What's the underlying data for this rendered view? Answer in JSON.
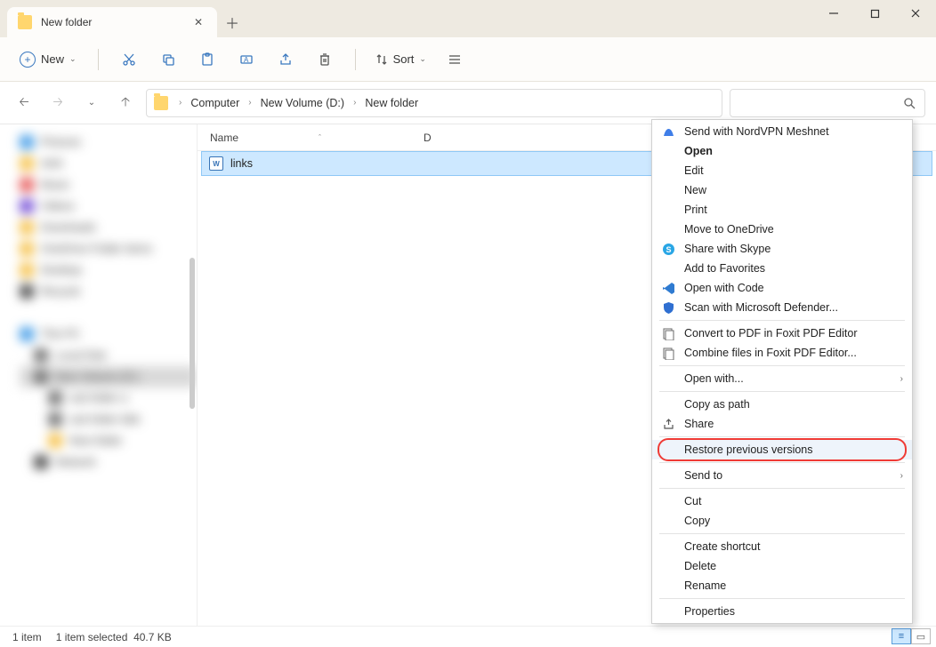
{
  "tab": {
    "title": "New folder"
  },
  "toolbar": {
    "new_label": "New",
    "sort_label": "Sort"
  },
  "breadcrumbs": [
    "Computer",
    "New Volume (D:)",
    "New folder"
  ],
  "columns": {
    "name": "Name",
    "date": "D",
    "size_header": ""
  },
  "file": {
    "name": "links",
    "size": "41 KB"
  },
  "status": {
    "count": "1 item",
    "selection": "1 item selected",
    "selsize": "40.7 KB"
  },
  "context_menu": [
    {
      "label": "Send with NordVPN Meshnet",
      "icon": "nord",
      "color": "#3f7ee8"
    },
    {
      "label": "Open",
      "bold": true
    },
    {
      "label": "Edit"
    },
    {
      "label": "New"
    },
    {
      "label": "Print"
    },
    {
      "label": "Move to OneDrive"
    },
    {
      "label": "Share with Skype",
      "icon": "skype",
      "color": "#29a6e5"
    },
    {
      "label": "Add to Favorites"
    },
    {
      "label": "Open with Code",
      "icon": "vscode",
      "color": "#2f7bd1"
    },
    {
      "label": "Scan with Microsoft Defender...",
      "icon": "shield",
      "color": "#2f6fd1"
    },
    {
      "sep": true
    },
    {
      "label": "Convert to PDF in Foxit PDF Editor",
      "icon": "pdf",
      "color": "#777"
    },
    {
      "label": "Combine files in Foxit PDF Editor...",
      "icon": "pdf2",
      "color": "#777"
    },
    {
      "sep": true
    },
    {
      "label": "Open with...",
      "sub": true
    },
    {
      "sep": true
    },
    {
      "label": "Copy as path"
    },
    {
      "label": "Share",
      "icon": "share",
      "color": "#555"
    },
    {
      "sep": true
    },
    {
      "label": "Restore previous versions",
      "ring": true,
      "hovered": true
    },
    {
      "sep": true
    },
    {
      "label": "Send to",
      "sub": true
    },
    {
      "sep": true
    },
    {
      "label": "Cut"
    },
    {
      "label": "Copy"
    },
    {
      "sep": true
    },
    {
      "label": "Create shortcut"
    },
    {
      "label": "Delete"
    },
    {
      "label": "Rename"
    },
    {
      "sep": true
    },
    {
      "label": "Properties"
    }
  ],
  "sidebar_items": [
    {
      "c": "#4aa0e8",
      "t": "Pictures"
    },
    {
      "c": "#f6c451",
      "t": "AAA"
    },
    {
      "c": "#e86161",
      "t": "Music"
    },
    {
      "c": "#7a55d8",
      "t": "Videos"
    },
    {
      "c": "#f6c451",
      "t": "Downloads"
    },
    {
      "c": "#f6c451",
      "t": "OneDrive Folder items"
    },
    {
      "c": "#f6c451",
      "t": "Desktop"
    },
    {
      "c": "#555",
      "t": "Recycle"
    },
    {
      "c": "",
      "t": ""
    },
    {
      "c": "#4aa0e8",
      "t": "This PC",
      "indent": 0
    },
    {
      "c": "#777",
      "t": "Local Disk",
      "indent": 1
    },
    {
      "c": "#777",
      "t": "New Volume (D:)",
      "indent": 1,
      "sel": true
    },
    {
      "c": "#777",
      "t": "sub folder a",
      "indent": 2
    },
    {
      "c": "#777",
      "t": "sub folder bbb",
      "indent": 2
    },
    {
      "c": "#f6c451",
      "t": "New folder",
      "indent": 2
    },
    {
      "c": "#555",
      "t": "Network",
      "indent": 1
    }
  ]
}
